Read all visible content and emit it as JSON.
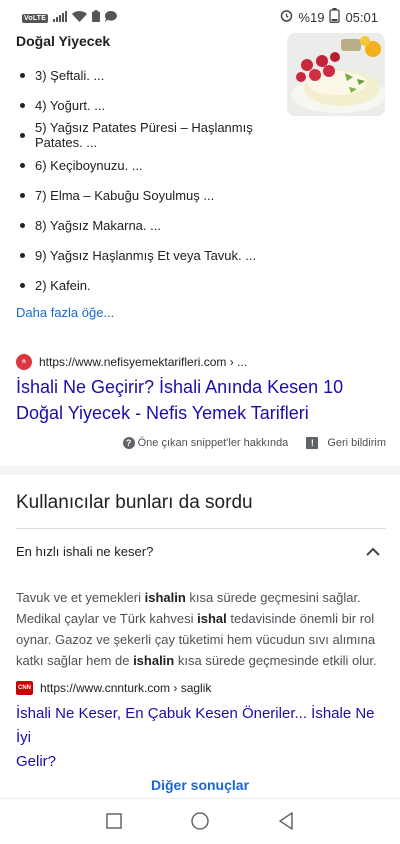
{
  "status_bar": {
    "volte": "VoLTE",
    "battery": "%19",
    "time": "05:01",
    "icons": [
      "volte-icon",
      "signal-icon",
      "wifi-icon",
      "battery-saver-icon",
      "message-icon",
      "alarm-icon",
      "battery-icon"
    ]
  },
  "snippet": {
    "heading": "Doğal Yiyecek",
    "image_icon": "yogurt-with-raspberries-image",
    "items": [
      "3) Şeftali. ...",
      "4) Yoğurt. ...",
      "5) Yağsız Patates Püresi – Haşlanmış Patates. ...",
      "6) Keçiboynuzu. ...",
      "7) Elma – Kabuğu Soyulmuş ...",
      "8) Yağsız Makarna. ...",
      "9) Yağsız Haşlanmış Et veya Tavuk. ...",
      "2) Kafein."
    ],
    "more_items": "Daha fazla öğe...",
    "source_url": "https://www.nefisyemektarifleri.com › ...",
    "title_line1": "İshali Ne Geçirir? İshali Anında Kesen 10",
    "title_line2": "Doğal Yiyecek - Nefis Yemek Tarifleri",
    "footer_about": "Öne çıkan snippet'ler hakkında",
    "footer_feedback": "Geri bildirim"
  },
  "paa": {
    "title": "Kullanıcılar bunları da sordu",
    "question": "En hızlı ishali ne keser?",
    "answer": {
      "p1": "Tavuk ve et yemekleri ",
      "b1": "ishalin",
      "p2": " kısa sürede geçmesini sağlar. Medikal çaylar ve Türk kahvesi ",
      "b2": "ishal",
      "p3": " tedavisinde önemli bir rol oynar. Gazoz ve şekerli çay tüketimi hem vücudun sıvı alımına katkı sağlar hem de ",
      "b3": "ishalin",
      "p4": " kısa sürede geçmesinde etkili olur."
    },
    "source_url": "https://www.cnnturk.com › saglik",
    "favicon_text": "CNN",
    "title_line1": "İshali Ne Keser, En Çabuk Kesen Öneriler... İshale Ne İyi",
    "title_line2": "Gelir?"
  },
  "more_results": "Diğer sonuçlar"
}
